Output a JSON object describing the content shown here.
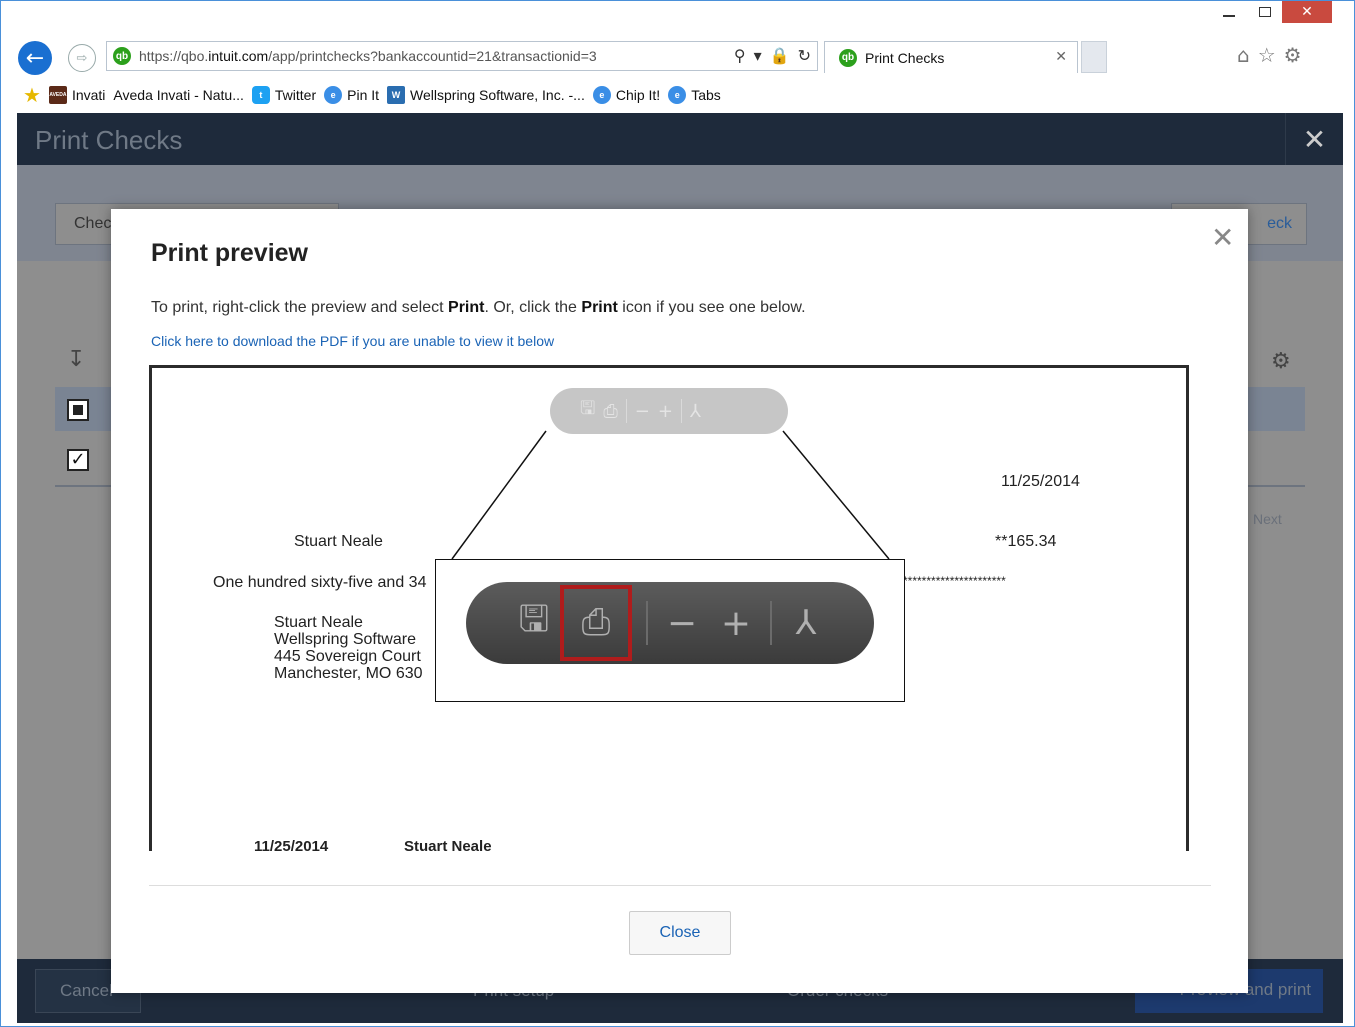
{
  "browser": {
    "url_prefix": "https://qbo.",
    "url_domain": "intuit.com",
    "url_path": "/app/printchecks?bankaccountid=21&transactionid=3",
    "tab_title": "Print Checks",
    "favorites": [
      {
        "label": "Invati",
        "icon": "aveda-icon"
      },
      {
        "label": "Aveda Invati - Natu...",
        "icon": "none"
      },
      {
        "label": "Twitter",
        "icon": "twitter-icon"
      },
      {
        "label": "Pin It",
        "icon": "ie-page-icon"
      },
      {
        "label": "Wellspring Software, Inc. -...",
        "icon": "wellspring-icon"
      },
      {
        "label": "Chip It!",
        "icon": "ie-page-icon"
      },
      {
        "label": "Tabs",
        "icon": "ie-page-icon"
      }
    ]
  },
  "app": {
    "title": "Print Checks",
    "bg_select_label": "Chec",
    "bg_right_button": "eck",
    "bg_next": "Next",
    "footer": {
      "cancel": "Cancel",
      "print_setup": "Print setup",
      "order_checks": "Order checks",
      "preview_print": "Preview and print"
    }
  },
  "modal": {
    "title": "Print preview",
    "instr_1": "To print, right-click the preview and select ",
    "instr_bold_1": "Print",
    "instr_2": ". Or, click the ",
    "instr_bold_2": "Print",
    "instr_3": " icon if you see one below.",
    "pdf_link": "Click here to download the PDF if you are unable to view it below",
    "close_label": "Close"
  },
  "check": {
    "date": "11/25/2014",
    "payee": "Stuart Neale",
    "amount": "**165.34",
    "amount_words": "One hundred sixty-five and 34",
    "stars": "**********************",
    "address": [
      "Stuart Neale",
      "Wellspring Software",
      "445 Sovereign Court",
      "Manchester, MO  630"
    ],
    "stub_date": "11/25/2014",
    "stub_payee": "Stuart Neale"
  },
  "colors": {
    "header_bg": "#1e2a3b",
    "link_blue": "#1a63b5",
    "highlight_red": "#b01c1c"
  }
}
